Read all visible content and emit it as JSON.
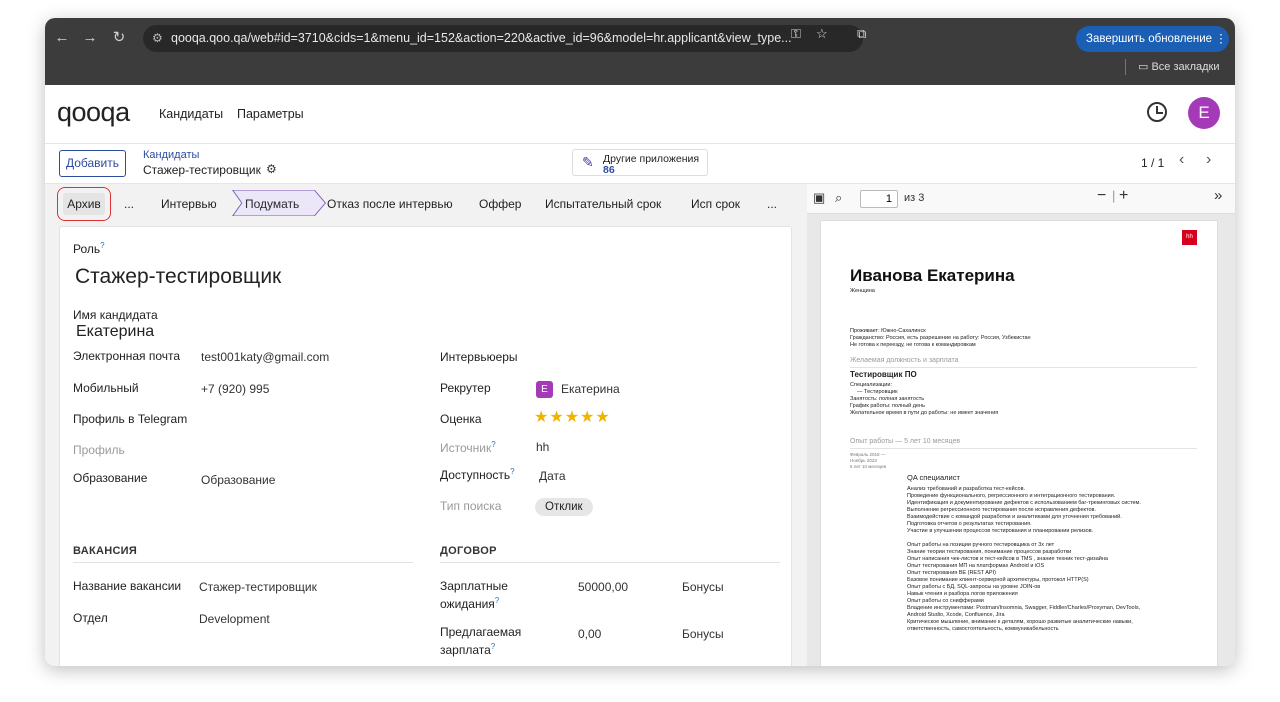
{
  "browser": {
    "url": "qooqa.qoo.qa/web#id=3710&cids=1&menu_id=152&action=220&active_id=96&model=hr.applicant&view_type...",
    "update_button": "Завершить обновление",
    "bookmarks_label": "Все закладки"
  },
  "app": {
    "logo": "qooqa",
    "nav": [
      "Кандидаты",
      "Параметры"
    ],
    "avatar_letter": "E"
  },
  "control": {
    "add_button": "Добавить",
    "breadcrumb_parent": "Кандидаты",
    "breadcrumb_current": "Стажер-тестировщик",
    "other_apps_label": "Другие приложения",
    "other_apps_count": "86",
    "pager": "1 / 1"
  },
  "stages": {
    "archive": "Архив",
    "ellipsis": "...",
    "interview": "Интервью",
    "think": "Подумать",
    "refusal": "Отказ после интервью",
    "offer": "Оффер",
    "probation": "Испытательный срок",
    "probation_short": "Исп срок",
    "more": "..."
  },
  "form": {
    "role_label": "Роль",
    "role_value": "Стажер-тестировщик",
    "candidate_label": "Имя кандидата",
    "candidate_value": "Екатерина",
    "email_label": "Электронная почта",
    "email_value": "test001katy@gmail.com",
    "mobile_label": "Мобильный",
    "mobile_value": "+7 (920) 995",
    "telegram_label": "Профиль в Telegram",
    "profile_label": "Профиль",
    "education_label": "Образование",
    "education_placeholder": "Образование",
    "interviewers_label": "Интервьюеры",
    "recruiter_label": "Рекрутер",
    "recruiter_value": "Екатерина",
    "recruiter_initial": "E",
    "rating_label": "Оценка",
    "rating_stars": 5,
    "source_label": "Источник",
    "source_value": "hh",
    "availability_label": "Доступность",
    "availability_placeholder": "Дата",
    "search_type_label": "Тип поиска",
    "search_type_value": "Отклик",
    "vacancy_section": "ВАКАНСИЯ",
    "vacancy_name_label": "Название вакансии",
    "vacancy_name_value": "Стажер-тестировщик",
    "department_label": "Отдел",
    "department_value": "Development",
    "contract_section": "ДОГОВОР",
    "salary_expected_label_1": "Зарплатные",
    "salary_expected_label_2": "ожидания",
    "salary_expected_value": "50000,00",
    "bonus_placeholder": "Бонусы",
    "salary_proposed_label_1": "Предлагаемая",
    "salary_proposed_label_2": "зарплата",
    "salary_proposed_value": "0,00",
    "help_mark": "?"
  },
  "pdf": {
    "page_current": "1",
    "page_total": "из 3",
    "logo": "hh",
    "name": "Иванова Екатерина",
    "gender": "Женщина",
    "lives": "Проживает: Южно-Сахалинск",
    "citizenship": "Гражданство: Россия, есть разрешение на работу: Россия, Узбекистан",
    "relocation": "Не готова к переезду, не готова к командировкам",
    "desired_head": "Желаемая должность и зарплата",
    "desired_title": "Тестировщик ПО",
    "spec_label": "Специализации:",
    "spec_item": "— Тестировщик",
    "employment": "Занятость: полная занятость",
    "schedule": "График работы: полный день",
    "commute": "Желательное время в пути до работы: не имеет значения",
    "exp_head": "Опыт работы — 5 лет 10 месяцев",
    "exp_period_1": "Февраль 2018 —",
    "exp_period_2": "Ноябрь 2023",
    "exp_period_3": "5 лет 10 месяцев",
    "exp_title": "QA специалист",
    "exp_lines": [
      "Анализ требований и разработка тест-кейсов.",
      "Проведение функционального, регрессионного и интеграционного тестирования.",
      "Идентификация и документирование дефектов с использованием баг-трекинговых систем.",
      "Выполнение регрессионного тестирования после исправления дефектов.",
      "Взаимодействие с командой разработки и аналитиками для уточнения требований.",
      "Подготовка отчетов о результатах тестирования.",
      "Участие в улучшении процессов тестирования и планировании релизов."
    ],
    "skills_lines": [
      "Опыт работы на позиции ручного тестировщика от 3х лет",
      "Знание теории тестирования, понимание процессов разработки",
      "Опыт написания чек-листов и тест-кейсов в TMS , знание техник тест-дизайна",
      "Опыт тестирования МП на платформах Android и iOS",
      "Опыт тестирования BE (REST API)",
      "Базовое понимание клиент-серверной архитектуры, протокол HTTP(S)",
      "Опыт работы с БД, SQL-запросы на уровне JOIN-ов",
      "Навык чтения и разбора логов приложения",
      "Опыт работы со снифферами",
      "Владение инструментами: Postman/Insomnia, Swagger, Fiddler/Charles/Proxyman, DevTools,",
      "Android Studio, Xcode, Confluence, Jira",
      "Критическое мышление, внимание к деталям, хорошо развитые аналитические навыки,",
      "ответственность, самостоятельность, коммуникабельность"
    ]
  },
  "colors": {
    "accent": "#2d4da0",
    "avatar": "#a43ab8",
    "stars": "#f0b400",
    "update_button": "#1a5fb4"
  }
}
